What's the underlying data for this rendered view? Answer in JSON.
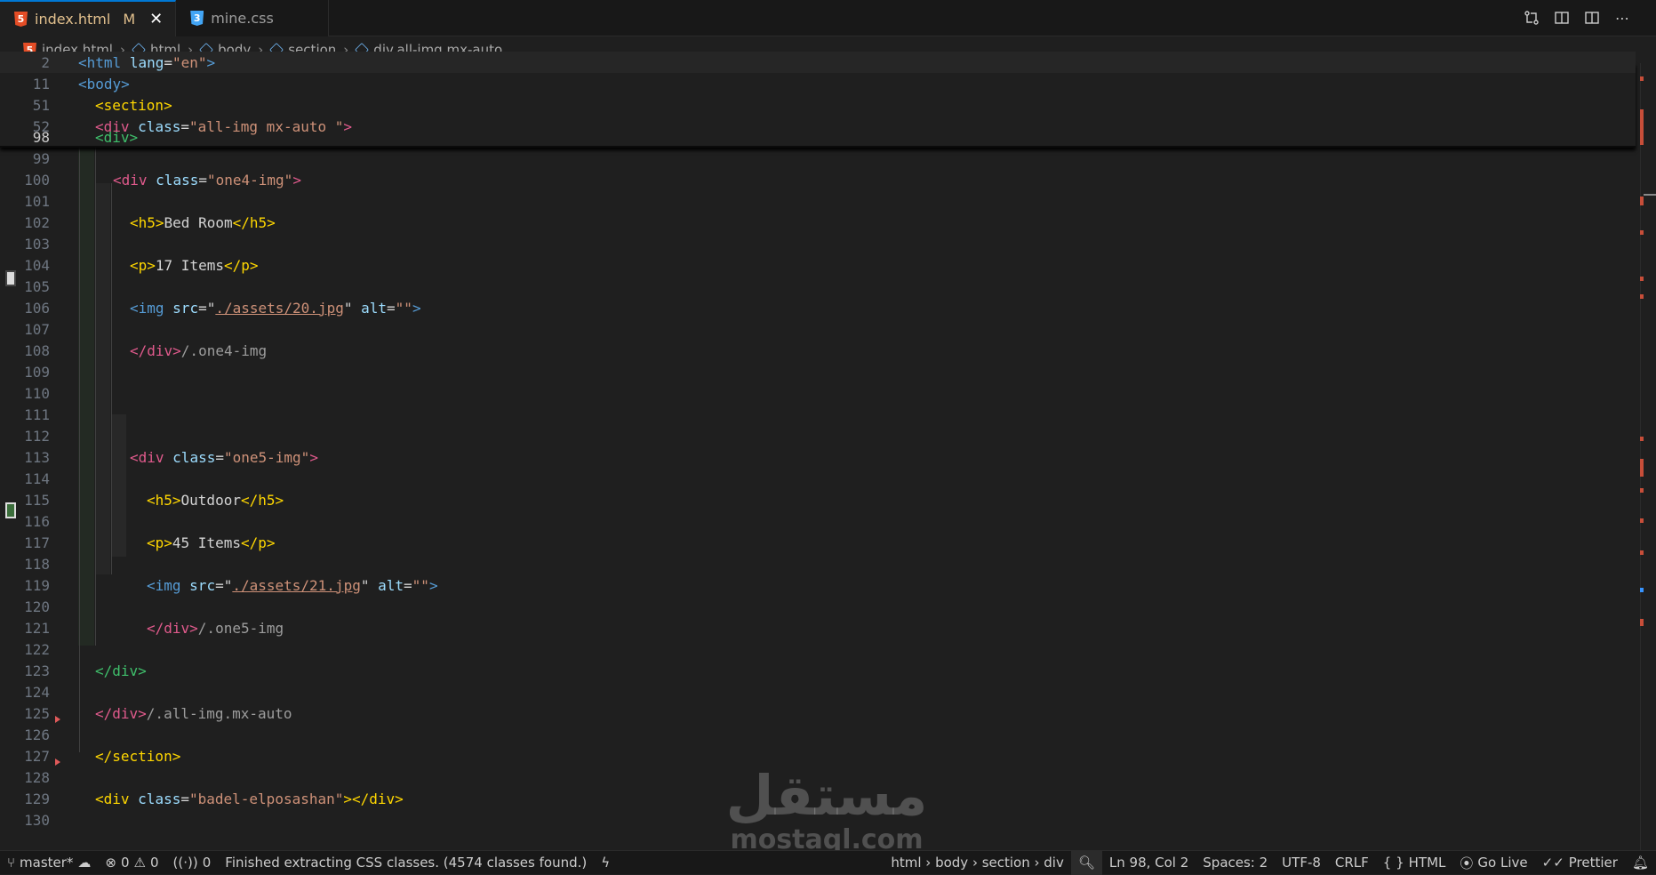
{
  "tabs": [
    {
      "label": "index.html",
      "modified": "M",
      "icon": "html5-icon",
      "active": true
    },
    {
      "label": "mine.css",
      "icon": "css3-icon",
      "active": false
    }
  ],
  "breadcrumb": [
    "index.html",
    "html",
    "body",
    "section",
    "div.all-img.mx-auto."
  ],
  "lines": {
    "l2": "2",
    "l11": "11",
    "l51": "51",
    "l52": "52",
    "l98": "98",
    "l99": "99",
    "l100": "100",
    "l101": "101",
    "l102": "102",
    "l103": "103",
    "l104": "104",
    "l105": "105",
    "l106": "106",
    "l107": "107",
    "l108": "108",
    "l109": "109",
    "l110": "110",
    "l111": "111",
    "l112": "112",
    "l113": "113",
    "l114": "114",
    "l115": "115",
    "l116": "116",
    "l117": "117",
    "l118": "118",
    "l119": "119",
    "l120": "120",
    "l121": "121",
    "l122": "122",
    "l123": "123",
    "l124": "124",
    "l125": "125",
    "l126": "126",
    "l127": "127",
    "l128": "128",
    "l129": "129",
    "l130": "130"
  },
  "code": {
    "html_attr": "lang",
    "html_val": "\"en\"",
    "div_class_52": "\"all-img mx-auto \"",
    "class_100": "\"one4-img\"",
    "h5_102": "Bed Room",
    "p_104": "17 Items",
    "src_106": "./assets/20.jpg",
    "cmt_108": "/.one4-img",
    "class_113": "\"one5-img\"",
    "h5_115": "Outdoor",
    "p_117": "45 Items",
    "src_119": "./assets/21.jpg",
    "cmt_121": "/.one5-img",
    "cmt_125": "/.all-img.mx-auto",
    "class_129": "\"badel-elposashan\""
  },
  "status": {
    "branch": "master*",
    "errors": "0",
    "warnings": "0",
    "ports": "0",
    "message": "Finished extracting CSS classes. (4574 classes found.)",
    "path": "html › body › section › div",
    "position": "Ln 98, Col 2",
    "spaces": "Spaces: 2",
    "encoding": "UTF-8",
    "eol": "CRLF",
    "language": "HTML",
    "golive": "Go Live",
    "prettier": "Prettier"
  },
  "watermark": {
    "arabic": "مستقل",
    "latin": "mostaql.com"
  }
}
